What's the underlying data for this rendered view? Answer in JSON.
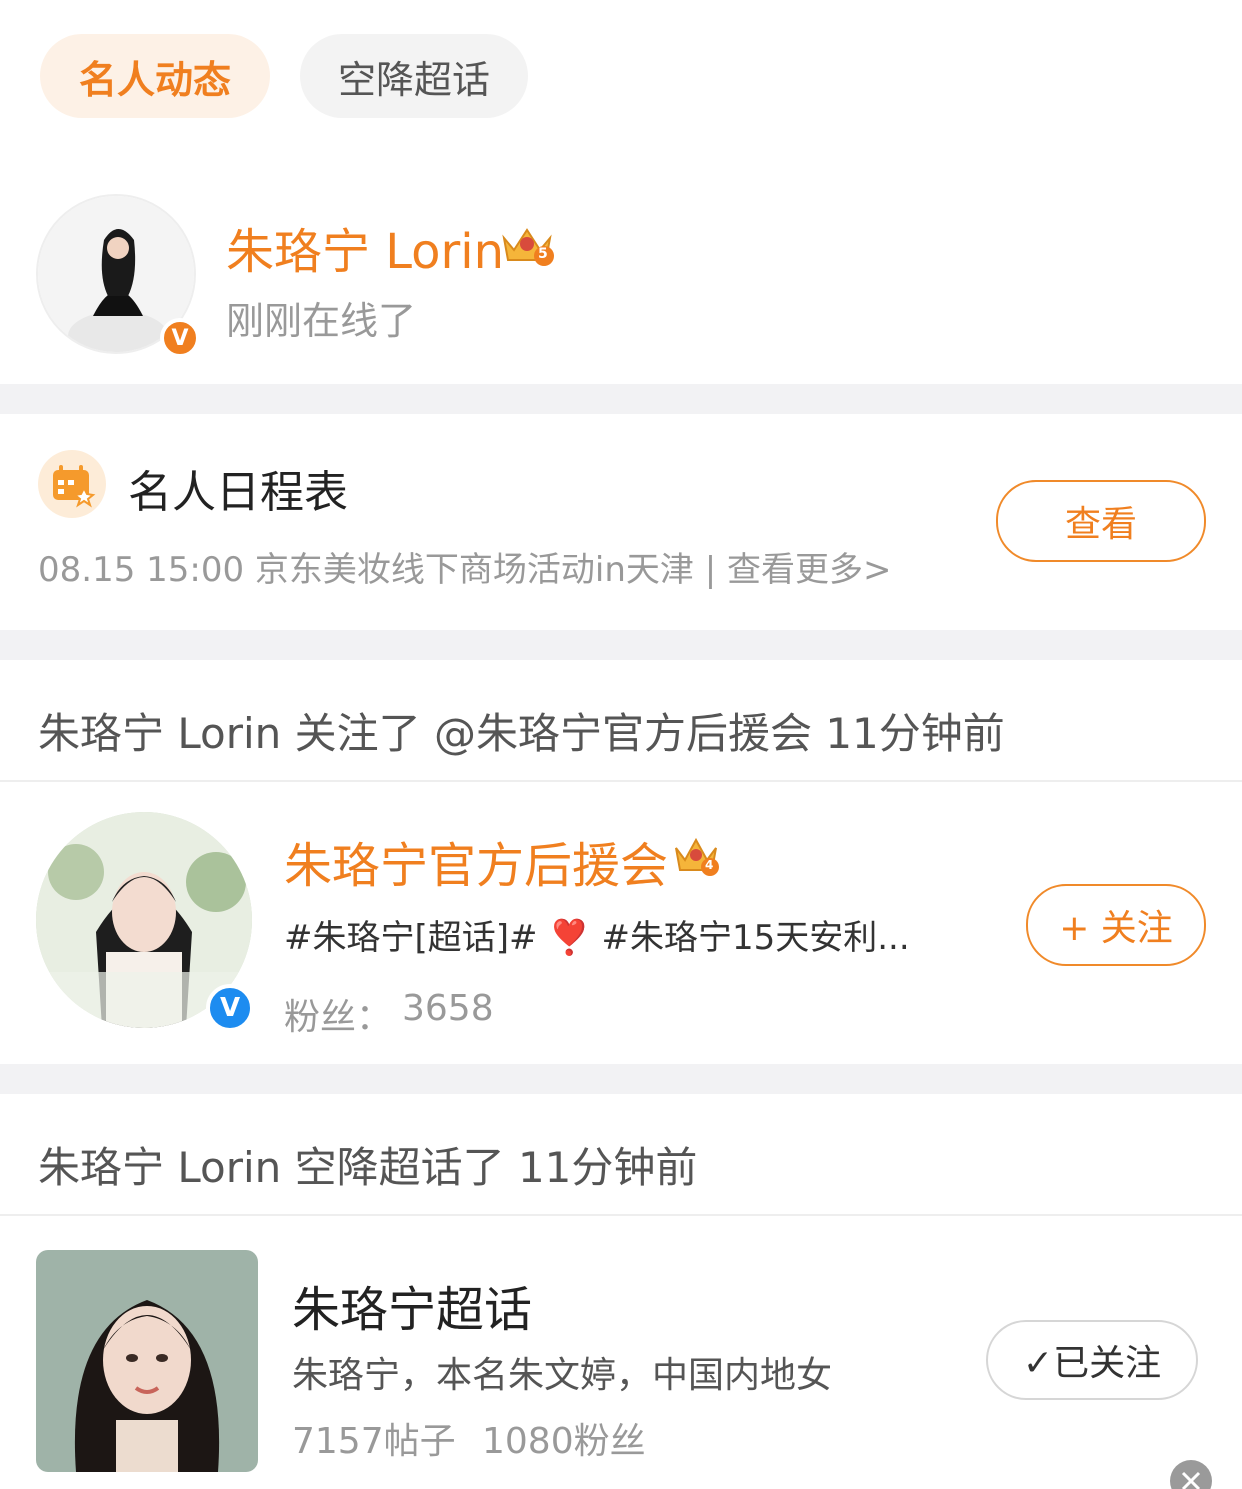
{
  "tabs": {
    "active_label": "名人动态",
    "inactive_label": "空降超话"
  },
  "profile": {
    "name": "朱珞宁 Lorin",
    "status": "刚刚在线了",
    "verified_badge": "V",
    "crown_badge": "5"
  },
  "schedule": {
    "title": "名人日程表",
    "event_text": "08.15 15:00 京东美妆线下商场活动in天津 |  查看更多>",
    "view_button": "查看"
  },
  "follow_activity": {
    "text": "朱珞宁 Lorin 关注了 @朱珞宁官方后援会 11分钟前",
    "account_name": "朱珞宁官方后援会",
    "account_desc": "#朱珞宁[超话]# ❣️ #朱珞宁15天安利...",
    "fans_label": "粉丝：",
    "fans_count": "3658",
    "follow_button": "+ 关注",
    "crown_badge": "4",
    "verified_badge": "V"
  },
  "supertopic_activity": {
    "text": "朱珞宁 Lorin 空降超话了 11分钟前",
    "topic_name": "朱珞宁超话",
    "topic_desc": "朱珞宁，本名朱文婷，中国内地女",
    "posts": "7157帖子",
    "fans": "1080粉丝",
    "followed_button": "✓已关注"
  },
  "colors": {
    "accent_orange": "#f07f1f",
    "verified_blue": "#1d8cf0",
    "divider": "#f2f2f4"
  }
}
